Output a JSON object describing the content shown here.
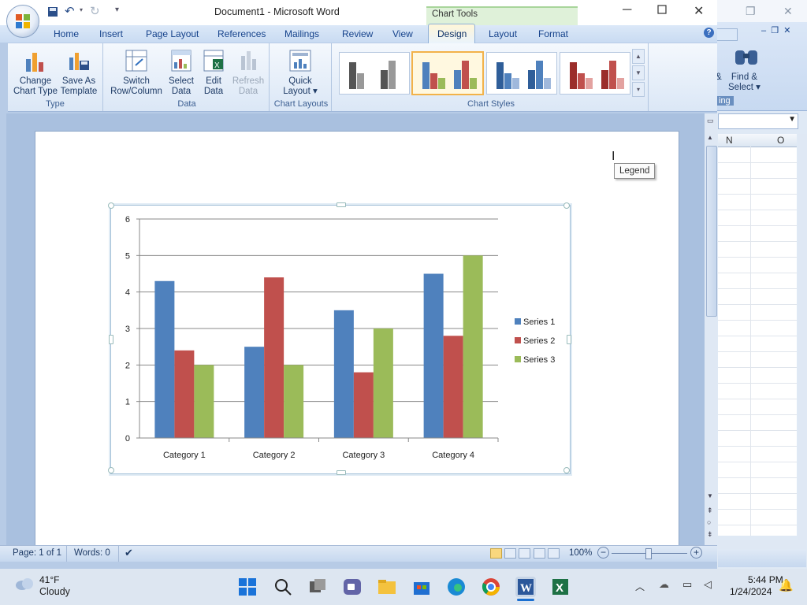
{
  "word": {
    "title": "Document1 - Microsoft Word",
    "context_label": "Chart Tools",
    "tabs": [
      "Home",
      "Insert",
      "Page Layout",
      "References",
      "Mailings",
      "Review",
      "View",
      "Design",
      "Layout",
      "Format"
    ],
    "active_tab": "Design",
    "ribbon": {
      "type_group": {
        "label": "Type",
        "change_chart_type": "Change Chart Type",
        "save_as_template": "Save As Template",
        "change_chart_type_l1": "Change",
        "change_chart_type_l2": "Chart Type",
        "save_as_template_l1": "Save As",
        "save_as_template_l2": "Template"
      },
      "data_group": {
        "label": "Data",
        "switch_l1": "Switch",
        "switch_l2": "Row/Column",
        "select_l1": "Select",
        "select_l2": "Data",
        "edit_l1": "Edit",
        "edit_l2": "Data",
        "refresh_l1": "Refresh",
        "refresh_l2": "Data"
      },
      "layouts_group": {
        "label": "Chart Layouts",
        "quick_l1": "Quick",
        "quick_l2": "Layout ▾"
      },
      "styles_group": {
        "label": "Chart Styles"
      }
    },
    "tooltip": "Legend",
    "status": {
      "page": "Page: 1 of 1",
      "words": "Words: 0",
      "zoom": "100%"
    }
  },
  "excel": {
    "ribbon_partial": {
      "find_select_l1": "Find &",
      "find_select_l2": "Select ▾",
      "amp": "&",
      "group_fragment": "ing"
    },
    "columns": [
      "N",
      "O"
    ]
  },
  "taskbar": {
    "weather_temp": "41°F",
    "weather_desc": "Cloudy",
    "time": "5:44 PM",
    "date": "1/24/2024"
  },
  "colors": {
    "series1": "#4f81bd",
    "series2": "#c0504d",
    "series3": "#9bbb59"
  },
  "chart_data": {
    "type": "bar",
    "categories": [
      "Category 1",
      "Category 2",
      "Category 3",
      "Category 4"
    ],
    "series": [
      {
        "name": "Series 1",
        "values": [
          4.3,
          2.5,
          3.5,
          4.5
        ]
      },
      {
        "name": "Series 2",
        "values": [
          2.4,
          4.4,
          1.8,
          2.8
        ]
      },
      {
        "name": "Series 3",
        "values": [
          2,
          2,
          3,
          5
        ]
      }
    ],
    "yticks": [
      "0",
      "1",
      "2",
      "3",
      "4",
      "5",
      "6"
    ],
    "ylim": [
      0,
      6
    ],
    "grid": true,
    "legend": "right"
  }
}
